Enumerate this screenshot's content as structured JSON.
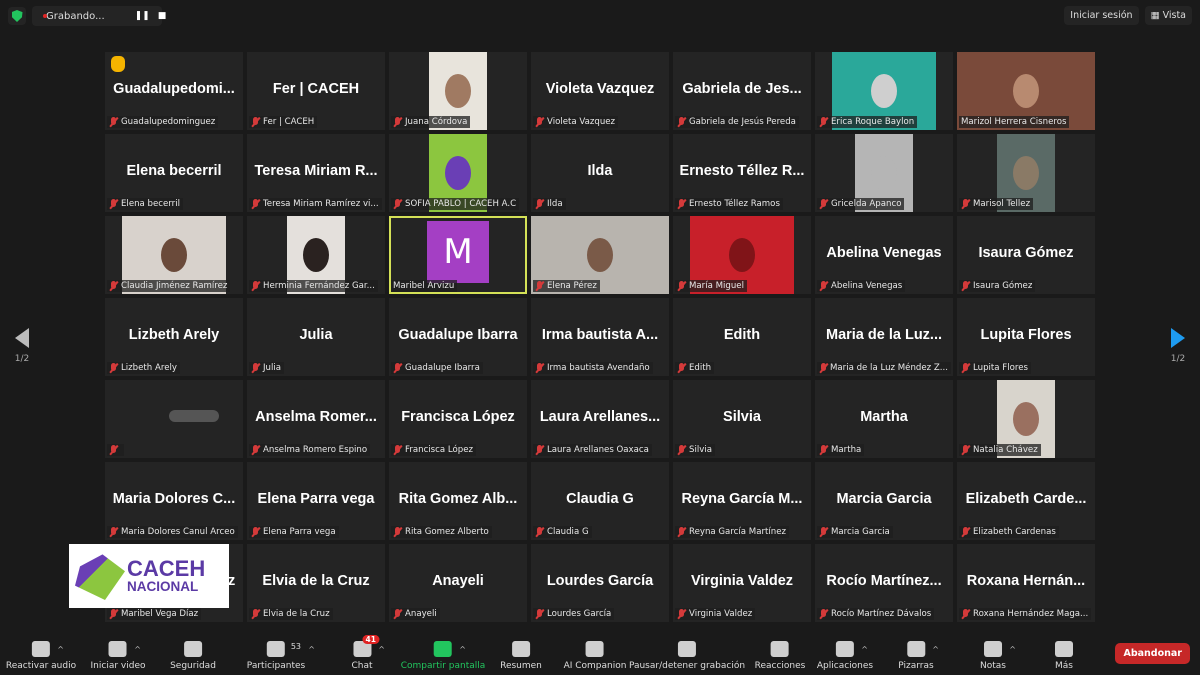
{
  "topbar": {
    "recording_label": "Grabando...",
    "pause_icon": "pause-icon",
    "stop_icon": "stop-icon",
    "sign_in": "Iniciar sesión",
    "view": "Vista"
  },
  "pagination": {
    "current": "1/2"
  },
  "colors": {
    "accent_active": "#d4e157",
    "mute": "#d43a3a",
    "share": "#22c55e",
    "leave": "#c62828",
    "next": "#1e9bf0"
  },
  "logo": {
    "line1": "CACEH",
    "line2": "NACIONAL"
  },
  "tiles": [
    {
      "name": "Guadalupedomi...",
      "label": "Guadalupedominguez",
      "muted": true,
      "hand": true
    },
    {
      "name": "Fer | CACEH",
      "label": "Fer | CACEH",
      "muted": true
    },
    {
      "video": "portrait",
      "bg": "#e8e4dc",
      "face": "#a07a62",
      "label": "Juana Córdova",
      "muted": true
    },
    {
      "name": "Violeta Vazquez",
      "label": "Violeta Vazquez",
      "muted": true
    },
    {
      "name": "Gabriela de Jes...",
      "label": "Gabriela de Jesús Pereda",
      "muted": true
    },
    {
      "video": "landscape",
      "bg": "#2aa89a",
      "face": "#cfcfcf",
      "label": "Erica Roque Baylon",
      "muted": true
    },
    {
      "video": "wide",
      "bg": "#7a4a3a",
      "face": "#b88a70",
      "label": "Marizol Herrera Cisneros",
      "muted": false
    },
    {
      "name": "Elena becerril",
      "label": "Elena becerril",
      "muted": true
    },
    {
      "name": "Teresa Miriam R...",
      "label": "Teresa Miriam Ramírez vi...",
      "muted": true
    },
    {
      "video": "portrait",
      "bg": "#8cc63f",
      "face": "#6a3fb5",
      "label": "SOFIA PABLO | CACEH A.C",
      "muted": true
    },
    {
      "name": "Ilda",
      "label": "Ilda",
      "muted": true
    },
    {
      "name": "Ernesto Téllez R...",
      "label": "Ernesto Téllez Ramos",
      "muted": true
    },
    {
      "video": "portrait",
      "bg": "#b5b5b5",
      "face": "#b5b5b5",
      "label": "Gricelda Apanco",
      "muted": true
    },
    {
      "video": "portrait",
      "bg": "#5a6a66",
      "face": "#8a7a66",
      "label": "Marisol Tellez",
      "muted": true
    },
    {
      "video": "landscape",
      "bg": "#d8d2cc",
      "face": "#6a4a3a",
      "label": "Claudia Jiménez Ramírez",
      "muted": true
    },
    {
      "video": "portrait",
      "bg": "#e4e0dc",
      "face": "#2a2220",
      "label": "Herminia Fernández Gar...",
      "muted": true
    },
    {
      "avatar": "M",
      "label": "Maribel Arvizu",
      "muted": false,
      "active": true
    },
    {
      "video": "full",
      "bg": "#b8b4ae",
      "face": "#7a5a48",
      "label": "Elena Pérez",
      "muted": true
    },
    {
      "video": "landscape",
      "bg": "#c8202a",
      "face": "#801418",
      "label": "María Miguel",
      "muted": true
    },
    {
      "name": "Abelina Venegas",
      "label": "Abelina Venegas",
      "muted": true
    },
    {
      "name": "Isaura Gómez",
      "label": "Isaura Gómez",
      "muted": true
    },
    {
      "name": "Lizbeth Arely",
      "label": "Lizbeth Arely",
      "muted": true
    },
    {
      "name": "Julia",
      "label": "Julia",
      "muted": true
    },
    {
      "name": "Guadalupe Ibarra",
      "label": "Guadalupe Ibarra",
      "muted": true
    },
    {
      "name": "Irma bautista A...",
      "label": "Irma bautista Avendaño",
      "muted": true
    },
    {
      "name": "Edith",
      "label": "Edith",
      "muted": true
    },
    {
      "name": "Maria de la Luz...",
      "label": "Maria de la Luz Méndez Z...",
      "muted": true
    },
    {
      "name": "Lupita Flores",
      "label": "Lupita Flores",
      "muted": true
    },
    {
      "blurred": true,
      "label": "",
      "muted": true
    },
    {
      "name": "Anselma Romer...",
      "label": "Anselma Romero Espino",
      "muted": true
    },
    {
      "name": "Francisca López",
      "label": "Francisca López",
      "muted": true
    },
    {
      "name": "Laura Arellanes...",
      "label": "Laura Arellanes Oaxaca",
      "muted": true
    },
    {
      "name": "Silvia",
      "label": "Silvia",
      "muted": true
    },
    {
      "name": "Martha",
      "label": "Martha",
      "muted": true
    },
    {
      "video": "portrait",
      "bg": "#d8d4cc",
      "face": "#9a7060",
      "label": "Natalia Chávez",
      "muted": true
    },
    {
      "name": "Maria Dolores C...",
      "label": "Maria Dolores Canul Arceo",
      "muted": true
    },
    {
      "name": "Elena Parra  vega",
      "label": "Elena Parra  vega",
      "muted": true
    },
    {
      "name": "Rita Gomez Alb...",
      "label": "Rita Gomez Alberto",
      "muted": true
    },
    {
      "name": "Claudia G",
      "label": "Claudia G",
      "muted": true
    },
    {
      "name": "Reyna García M...",
      "label": "Reyna García Martínez",
      "muted": true
    },
    {
      "name": "Marcia Garcia",
      "label": "Marcia Garcia",
      "muted": true
    },
    {
      "name": "Elizabeth Carde...",
      "label": "Elizabeth Cardenas",
      "muted": true
    },
    {
      "name": "Maribel Vega Díaz",
      "label": "Maribel Vega Díaz",
      "muted": true
    },
    {
      "name": "Elvia de la Cruz",
      "label": "Elvia de la Cruz",
      "muted": true
    },
    {
      "name": "Anayeli",
      "label": "Anayeli",
      "muted": true
    },
    {
      "name": "Lourdes García",
      "label": "Lourdes García",
      "muted": true
    },
    {
      "name": "Virginia Valdez",
      "label": "Virginia Valdez",
      "muted": true
    },
    {
      "name": "Rocío Martínez...",
      "label": "Rocío Martínez Dávalos",
      "muted": true
    },
    {
      "name": "Roxana Hernán...",
      "label": "Roxana Hernández Maga...",
      "muted": true
    }
  ],
  "toolbar": [
    {
      "label": "Reactivar audio",
      "icon": "mic-muted-icon",
      "caret": true
    },
    {
      "label": "Iniciar video",
      "icon": "video-off-icon",
      "caret": true
    },
    {
      "label": "Seguridad",
      "icon": "shield-icon"
    },
    {
      "label": "Participantes",
      "icon": "participants-icon",
      "count": "53",
      "caret": true
    },
    {
      "label": "Chat",
      "icon": "chat-icon",
      "badge": "41",
      "caret": true
    },
    {
      "label": "Compartir pantalla",
      "icon": "share-screen-icon",
      "caret": true,
      "green": true
    },
    {
      "label": "Resumen",
      "icon": "summary-icon"
    },
    {
      "label": "AI Companion",
      "icon": "ai-sparkle-icon"
    },
    {
      "label": "Pausar/detener grabación",
      "icon": "pause-stop-recording-icon"
    },
    {
      "label": "Reacciones",
      "icon": "reactions-icon"
    },
    {
      "label": "Aplicaciones",
      "icon": "apps-icon",
      "caret": true
    },
    {
      "label": "Pizarras",
      "icon": "whiteboard-icon",
      "caret": true
    },
    {
      "label": "Notas",
      "icon": "notes-icon",
      "caret": true
    },
    {
      "label": "Más",
      "icon": "more-icon"
    }
  ],
  "leave": "Abandonar"
}
